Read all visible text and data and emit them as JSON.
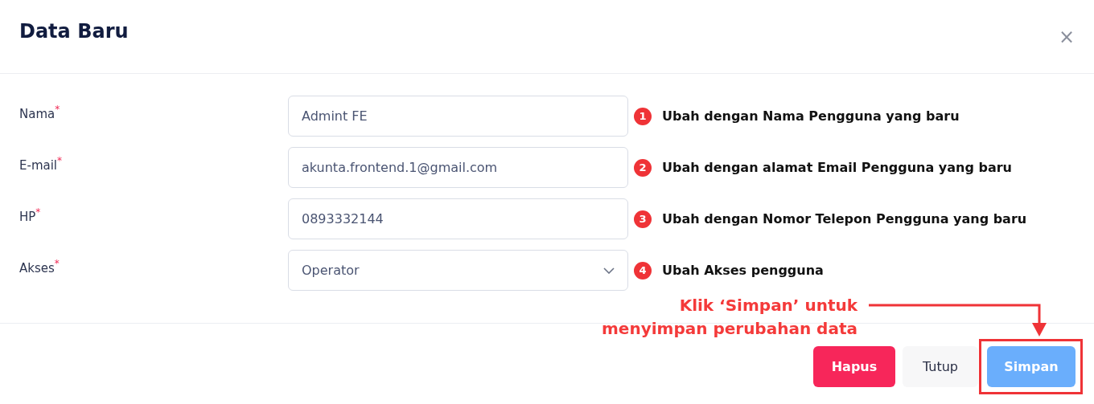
{
  "dialog": {
    "title": "Data Baru",
    "close_icon": "×"
  },
  "fields": [
    {
      "label": "Nama",
      "required_mark": "*",
      "kind": "text",
      "value": "Admint FE",
      "step": "1",
      "hint": "Ubah dengan Nama Pengguna yang baru"
    },
    {
      "label": "E-mail",
      "required_mark": "*",
      "kind": "text",
      "value": "akunta.frontend.1@gmail.com",
      "step": "2",
      "hint": "Ubah dengan alamat Email Pengguna yang baru"
    },
    {
      "label": "HP",
      "required_mark": "*",
      "kind": "text",
      "value": "0893332144",
      "step": "3",
      "hint": "Ubah dengan Nomor Telepon Pengguna yang baru"
    },
    {
      "label": "Akses",
      "required_mark": "*",
      "kind": "select",
      "value": "Operator",
      "step": "4",
      "hint": "Ubah Akses pengguna"
    }
  ],
  "callout": {
    "lines": [
      "Klik ‘Simpan’ untuk",
      "menyimpan perubahan data"
    ]
  },
  "buttons": [
    {
      "label": "Hapus",
      "kind": "danger",
      "highlighted": false
    },
    {
      "label": "Tutup",
      "kind": "secondary",
      "highlighted": false
    },
    {
      "label": "Simpan",
      "kind": "primary",
      "highlighted": true
    }
  ]
}
